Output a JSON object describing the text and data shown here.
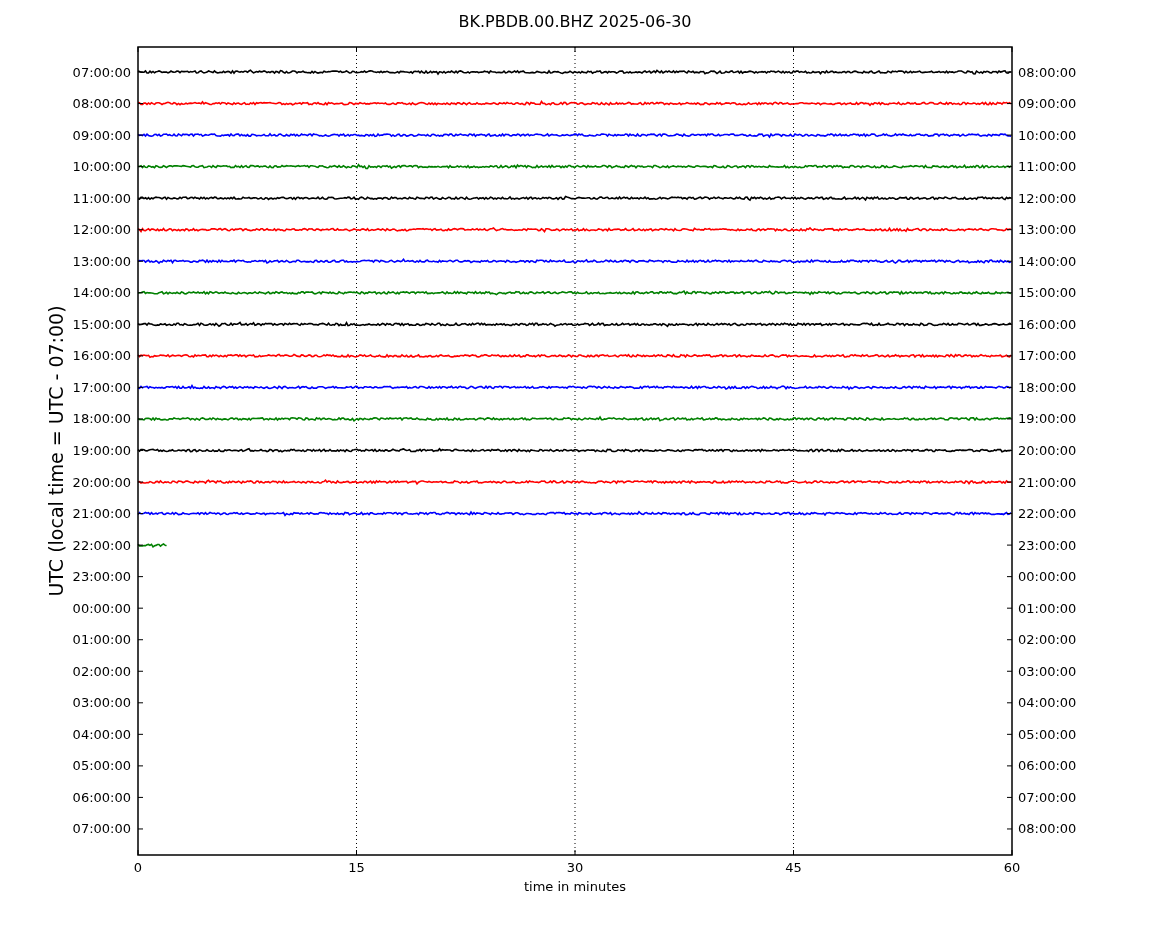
{
  "title": "BK.PBDB.00.BHZ 2025-06-30",
  "ylabel": "UTC (local time = UTC - 07:00)",
  "xlabel": "time in minutes",
  "xticks": [
    "0",
    "15",
    "30",
    "45",
    "60"
  ],
  "left_labels": [
    "07:00:00",
    "08:00:00",
    "09:00:00",
    "10:00:00",
    "11:00:00",
    "12:00:00",
    "13:00:00",
    "14:00:00",
    "15:00:00",
    "16:00:00",
    "17:00:00",
    "18:00:00",
    "19:00:00",
    "20:00:00",
    "21:00:00",
    "22:00:00",
    "23:00:00",
    "00:00:00",
    "01:00:00",
    "02:00:00",
    "03:00:00",
    "04:00:00",
    "05:00:00",
    "06:00:00",
    "07:00:00"
  ],
  "right_labels": [
    "08:00:00",
    "09:00:00",
    "10:00:00",
    "11:00:00",
    "12:00:00",
    "13:00:00",
    "14:00:00",
    "15:00:00",
    "16:00:00",
    "17:00:00",
    "18:00:00",
    "19:00:00",
    "20:00:00",
    "21:00:00",
    "22:00:00",
    "23:00:00",
    "00:00:00",
    "01:00:00",
    "02:00:00",
    "03:00:00",
    "04:00:00",
    "05:00:00",
    "06:00:00",
    "07:00:00",
    "08:00:00"
  ],
  "traces": [
    {
      "color": "#000000",
      "level": 1
    },
    {
      "color": "#ff0000",
      "level": 1
    },
    {
      "color": "#0000ff",
      "level": 1
    },
    {
      "color": "#008000",
      "level": 1
    },
    {
      "color": "#000000",
      "level": 1
    },
    {
      "color": "#ff0000",
      "level": 1
    },
    {
      "color": "#0000ff",
      "level": 1
    },
    {
      "color": "#008000",
      "level": 1
    },
    {
      "color": "#000000",
      "level": 1
    },
    {
      "color": "#ff0000",
      "level": 1
    },
    {
      "color": "#0000ff",
      "level": 1
    },
    {
      "color": "#008000",
      "level": 1
    },
    {
      "color": "#000000",
      "level": 1
    },
    {
      "color": "#ff0000",
      "level": 1
    },
    {
      "color": "#0000ff",
      "level": 1
    },
    {
      "color": "#008000",
      "level": 0.033
    }
  ]
}
